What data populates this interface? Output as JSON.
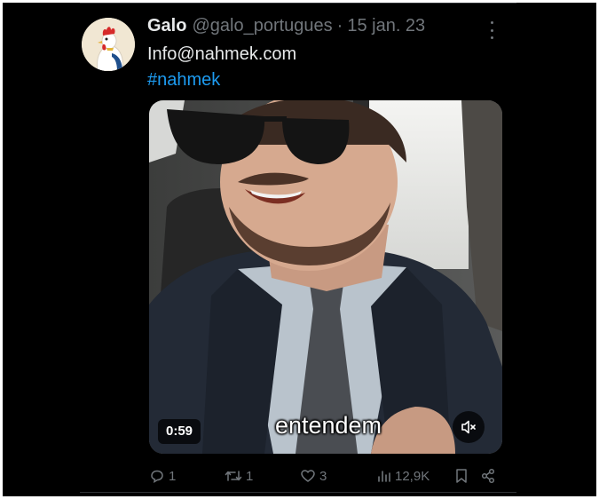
{
  "tweet": {
    "author_name": "Galo",
    "author_handle": "@galo_portugues",
    "separator": "·",
    "date": "15 jan. 23",
    "lines": [
      "Info@nahmek.com"
    ],
    "hashtag": "#nahmek"
  },
  "media": {
    "duration": "0:59",
    "caption": "entendem",
    "mute_icon": "speaker-muted-icon"
  },
  "actions": {
    "reply_count": "1",
    "retweet_count": "1",
    "like_count": "3",
    "view_count": "12,9K"
  },
  "colors": {
    "background": "#000000",
    "text": "#e7e9ea",
    "muted": "#71767b",
    "link": "#1d9bf0"
  }
}
